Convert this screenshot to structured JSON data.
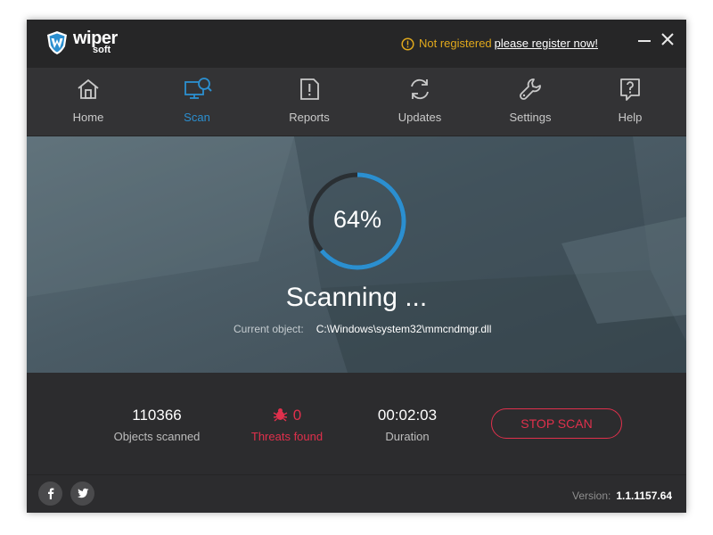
{
  "app": {
    "logo_word": "wiper",
    "logo_sub": "soft"
  },
  "titlebar": {
    "status": "Not registered",
    "register_link": "please register now!"
  },
  "nav": {
    "items": [
      {
        "label": "Home",
        "icon": "home-icon",
        "active": false
      },
      {
        "label": "Scan",
        "icon": "scan-icon",
        "active": true
      },
      {
        "label": "Reports",
        "icon": "reports-icon",
        "active": false
      },
      {
        "label": "Updates",
        "icon": "updates-icon",
        "active": false
      },
      {
        "label": "Settings",
        "icon": "settings-icon",
        "active": false
      },
      {
        "label": "Help",
        "icon": "help-icon",
        "active": false
      }
    ]
  },
  "scan": {
    "progress_percent": 64,
    "progress_text": "64%",
    "status": "Scanning ...",
    "current_object_label": "Current object:",
    "current_object_value": "C:\\Windows\\system32\\mmcndmgr.dll"
  },
  "stats": {
    "objects_scanned": "110366",
    "objects_scanned_label": "Objects scanned",
    "threats": "0",
    "threats_label": "Threats found",
    "duration": "00:02:03",
    "duration_label": "Duration"
  },
  "actions": {
    "stop_scan": "STOP SCAN"
  },
  "footer": {
    "version_label": "Version:",
    "version_value": "1.1.1157.64"
  },
  "colors": {
    "accent_blue": "#2b8fd0",
    "danger_red": "#e0304c",
    "warning_yellow": "#e0a81c",
    "background": "#2c2c2e"
  }
}
